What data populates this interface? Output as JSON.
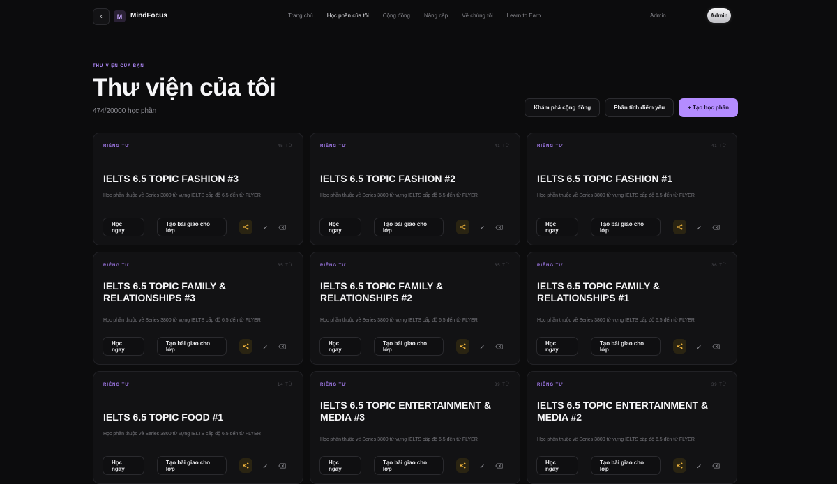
{
  "nav": {
    "back_icon": "chevron-left-icon",
    "logo_letter": "M",
    "brand": "MindFocus",
    "menu": [
      {
        "label": "Trang chủ",
        "active": false
      },
      {
        "label": "Học phần của tôi",
        "active": true
      },
      {
        "label": "Cộng đồng",
        "active": false
      },
      {
        "label": "Nâng cấp",
        "active": false
      },
      {
        "label": "Về chúng tôi",
        "active": false
      },
      {
        "label": "Learn to Earn",
        "active": false
      }
    ],
    "admin_link": "Admin",
    "admin_pill": "Admin"
  },
  "header": {
    "eyebrow": "THƯ VIỆN CỦA BẠN",
    "title": "Thư viện của tôi",
    "count": "474/20000 học phần",
    "actions": {
      "explore": "Khám phá cộng đồng",
      "analyze": "Phân tích điểm yếu",
      "create": "+ Tạo học phần"
    }
  },
  "card_labels": {
    "study": "Học ngay",
    "assign": "Tạo bài giao cho lớp"
  },
  "cards": [
    {
      "visibility": "RIÊNG TƯ",
      "terms": "45 TỪ",
      "title": "IELTS 6.5 TOPIC FASHION #3",
      "desc": "Học phần thuộc về Series 3800 từ vựng IELTS cấp độ 6.5 đến từ FLYER"
    },
    {
      "visibility": "RIÊNG TƯ",
      "terms": "41 TỪ",
      "title": "IELTS 6.5 TOPIC FASHION #2",
      "desc": "Học phần thuộc về Series 3800 từ vựng IELTS cấp độ 6.5 đến từ FLYER"
    },
    {
      "visibility": "RIÊNG TƯ",
      "terms": "41 TỪ",
      "title": "IELTS 6.5 TOPIC FASHION #1",
      "desc": "Học phần thuộc về Series 3800 từ vựng IELTS cấp độ 6.5 đến từ FLYER"
    },
    {
      "visibility": "RIÊNG TƯ",
      "terms": "35 TỪ",
      "title": "IELTS 6.5 TOPIC FAMILY & RELATIONSHIPS #3",
      "desc": "Học phần thuộc về Series 3800 từ vựng IELTS cấp độ 6.5 đến từ FLYER"
    },
    {
      "visibility": "RIÊNG TƯ",
      "terms": "35 TỪ",
      "title": "IELTS 6.5 TOPIC FAMILY & RELATIONSHIPS #2",
      "desc": "Học phần thuộc về Series 3800 từ vựng IELTS cấp độ 6.5 đến từ FLYER"
    },
    {
      "visibility": "RIÊNG TƯ",
      "terms": "36 TỪ",
      "title": "IELTS 6.5 TOPIC FAMILY & RELATIONSHIPS #1",
      "desc": "Học phần thuộc về Series 3800 từ vựng IELTS cấp độ 6.5 đến từ FLYER"
    },
    {
      "visibility": "RIÊNG TƯ",
      "terms": "14 TỪ",
      "title": "IELTS 6.5 TOPIC FOOD #1",
      "desc": "Học phần thuộc về Series 3800 từ vựng IELTS cấp độ 6.5 đến từ FLYER"
    },
    {
      "visibility": "RIÊNG TƯ",
      "terms": "39 TỪ",
      "title": "IELTS 6.5 TOPIC ENTERTAINMENT & MEDIA #3",
      "desc": "Học phần thuộc về Series 3800 từ vựng IELTS cấp độ 6.5 đến từ FLYER"
    },
    {
      "visibility": "RIÊNG TƯ",
      "terms": "39 TỪ",
      "title": "IELTS 6.5 TOPIC ENTERTAINMENT & MEDIA #2",
      "desc": "Học phần thuộc về Series 3800 từ vựng IELTS cấp độ 6.5 đến từ FLYER"
    }
  ],
  "colors": {
    "accent": "#b48cff",
    "share": "#f0b43c",
    "background": "#0c0c0d",
    "card": "#121214"
  },
  "icons": {
    "share": "share-icon",
    "edit": "pencil-icon",
    "delete": "backspace-icon"
  }
}
